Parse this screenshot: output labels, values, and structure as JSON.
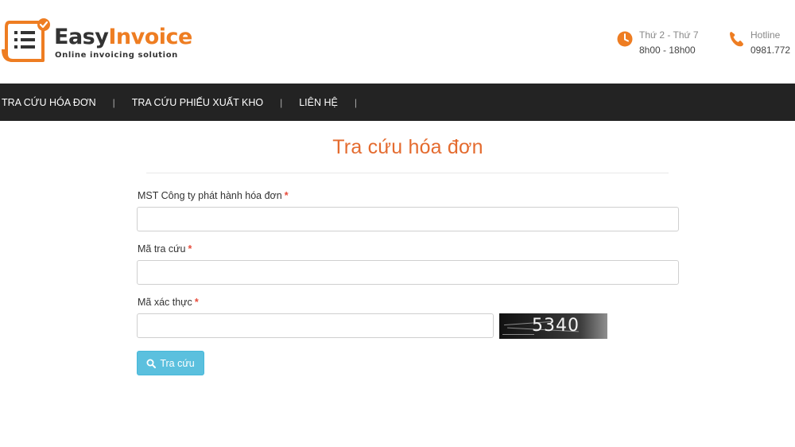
{
  "header": {
    "logo": {
      "title_part1": "Easy",
      "title_part2": "Invoice",
      "tagline": "Online invoicing solution"
    },
    "working_hours": {
      "label": "Thứ 2 - Thứ 7",
      "value": "8h00 - 18h00",
      "icon": "clock-icon"
    },
    "hotline": {
      "label": "Hotline",
      "value": "0981.772",
      "icon": "phone-icon"
    }
  },
  "nav": {
    "items": [
      {
        "label": "TRA CỨU HÓA ĐƠN"
      },
      {
        "label": "TRA CỨU PHIẾU XUẤT KHO"
      },
      {
        "label": "LIÊN HỆ"
      }
    ],
    "separator": "|"
  },
  "main": {
    "title": "Tra cứu hóa đơn",
    "form": {
      "mst_label": "MST Công ty phát hành hóa đơn",
      "mst_value": "",
      "lookup_code_label": "Mã tra cứu",
      "lookup_code_value": "",
      "captcha_label": "Mã xác thực",
      "captcha_value": "",
      "required_mark": "*",
      "captcha_image_text": "5340",
      "submit_label": "Tra cứu"
    }
  },
  "colors": {
    "brand_orange": "#ee7d22",
    "title_orange": "#e46b2f",
    "nav_bg": "#232323",
    "button_bg": "#5bc0de",
    "required": "#e74c3c"
  }
}
